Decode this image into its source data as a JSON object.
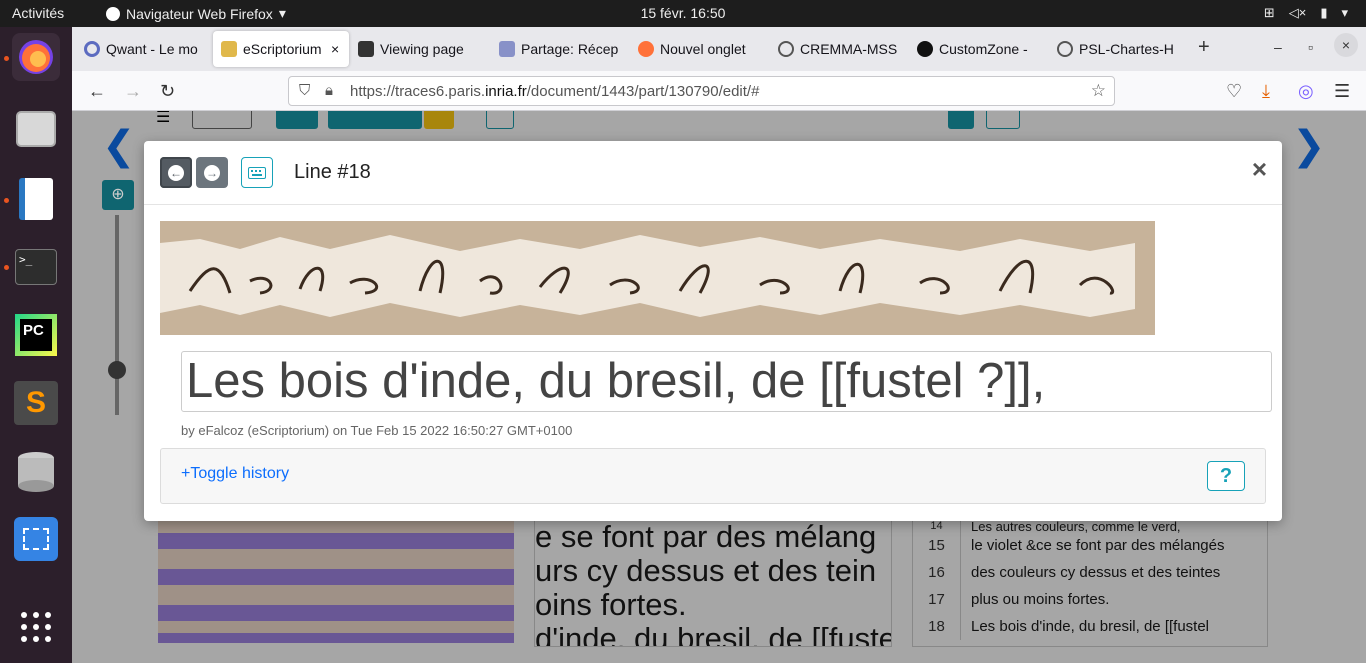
{
  "topbar": {
    "activities": "Activités",
    "app_name": "Navigateur Web Firefox",
    "clock": "15 févr.  16:50"
  },
  "browser": {
    "tabs": [
      {
        "label": "Qwant - Le mo",
        "active": false
      },
      {
        "label": "eScriptorium",
        "active": true
      },
      {
        "label": "Viewing page",
        "active": false
      },
      {
        "label": "Partage: Récep",
        "active": false
      },
      {
        "label": "Nouvel onglet",
        "active": false
      },
      {
        "label": "CREMMA-MSS",
        "active": false
      },
      {
        "label": "CustomZone -",
        "active": false
      },
      {
        "label": "PSL-Chartes-H",
        "active": false
      }
    ],
    "url_prefix": "https://traces6.paris.",
    "url_domain": "inria.fr",
    "url_suffix": "/document/1443/part/130790/edit/#"
  },
  "modal": {
    "title": "Line #18",
    "transcription": "Les bois d'inde, du bresil, de [[fustel ?]],",
    "meta": "by eFalcoz (eScriptorium) on Tue Feb 15 2022 16:50:27 GMT+0100",
    "toggle_history": "+Toggle history",
    "help": "?",
    "close": "×"
  },
  "background": {
    "text_lines": [
      "e se font par des mélang",
      "urs cy dessus et des tein",
      "oins fortes.",
      "d'inde, du bresil, de [[fuste"
    ],
    "list_rows": [
      {
        "num": "14",
        "text": "Les autres couleurs, comme le verd,"
      },
      {
        "num": "15",
        "text": "le violet &ce se font par des mélangés"
      },
      {
        "num": "16",
        "text": "des couleurs cy dessus et des teintes"
      },
      {
        "num": "17",
        "text": "plus ou moins fortes."
      },
      {
        "num": "18",
        "text": "Les bois d'inde, du bresil, de [[fustel"
      }
    ]
  },
  "colors": {
    "accent": "#17a2b8",
    "link": "#0d6efd",
    "dock": "#2c1f2b",
    "nav_arrow": "#0a4a9e"
  }
}
